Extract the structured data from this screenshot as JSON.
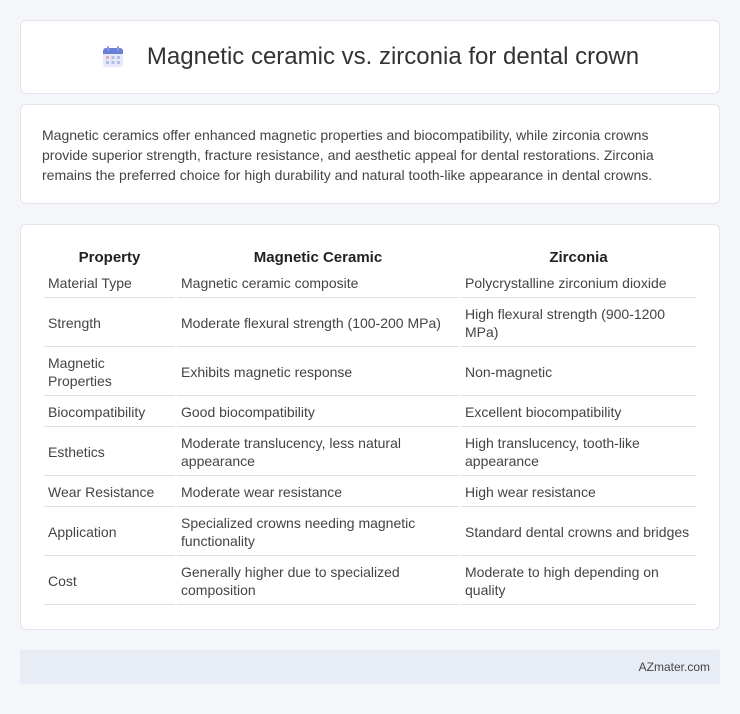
{
  "header": {
    "title": "Magnetic ceramic vs. zirconia for dental crown",
    "icon": "calendar-icon",
    "accent": "#6b7fd7"
  },
  "description": {
    "text": "Magnetic ceramics offer enhanced magnetic properties and biocompatibility, while zirconia crowns provide superior strength, fracture resistance, and aesthetic appeal for dental restorations. Zirconia remains the preferred choice for high durability and natural tooth-like appearance in dental crowns."
  },
  "table": {
    "headers": [
      "Property",
      "Magnetic Ceramic",
      "Zirconia"
    ],
    "rows": [
      [
        "Material Type",
        "Magnetic ceramic composite",
        "Polycrystalline zirconium dioxide"
      ],
      [
        "Strength",
        "Moderate flexural strength (100-200 MPa)",
        "High flexural strength (900-1200 MPa)"
      ],
      [
        "Magnetic Properties",
        "Exhibits magnetic response",
        "Non-magnetic"
      ],
      [
        "Biocompatibility",
        "Good biocompatibility",
        "Excellent biocompatibility"
      ],
      [
        "Esthetics",
        "Moderate translucency, less natural appearance",
        "High translucency, tooth-like appearance"
      ],
      [
        "Wear Resistance",
        "Moderate wear resistance",
        "High wear resistance"
      ],
      [
        "Application",
        "Specialized crowns needing magnetic functionality",
        "Standard dental crowns and bridges"
      ],
      [
        "Cost",
        "Generally higher due to specialized composition",
        "Moderate to high depending on quality"
      ]
    ]
  },
  "footer": {
    "brand": "AZmater.com"
  }
}
